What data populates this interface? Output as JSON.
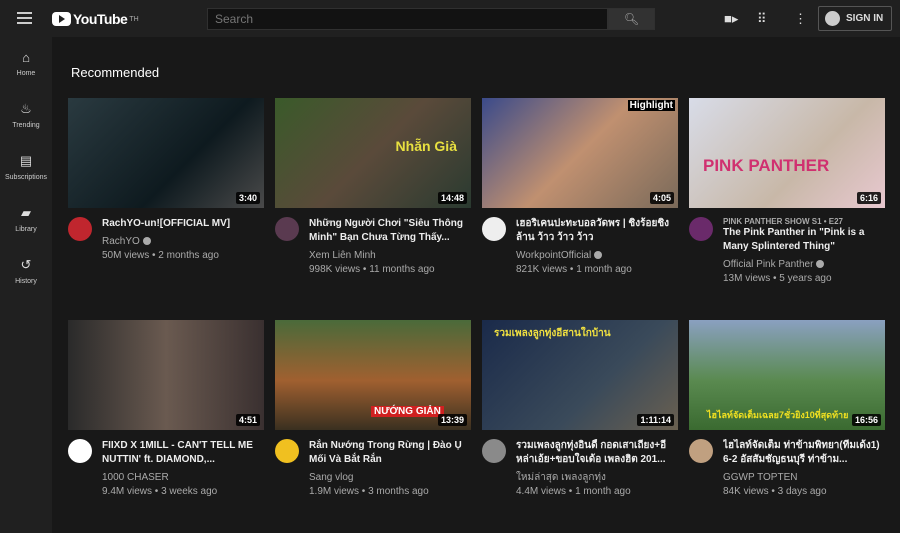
{
  "header": {
    "logo": "YouTube",
    "logo_sup": "TH",
    "search_placeholder": "Search",
    "sign_in": "SIGN IN"
  },
  "sidebar": [
    {
      "label": "Home",
      "icon": "home-icon",
      "glyph": "⌂"
    },
    {
      "label": "Trending",
      "icon": "flame-icon",
      "glyph": "♨"
    },
    {
      "label": "Subscriptions",
      "icon": "subscriptions-icon",
      "glyph": "▤"
    },
    {
      "label": "Library",
      "icon": "folder-icon",
      "glyph": "▰"
    },
    {
      "label": "History",
      "icon": "history-icon",
      "glyph": "↺"
    }
  ],
  "section_title": "Recommended",
  "videos": [
    {
      "title": "RachYO-un![OFFICIAL MV]",
      "channel": "RachYO",
      "verified": true,
      "views": "50M views • 2 months ago",
      "duration": "3:40",
      "thumb": "linear-gradient(135deg,#2a3a40,#0e1a1f 60%,#4a4a4a)",
      "avatar": "#c0262e",
      "overlay": ""
    },
    {
      "title": "Những Người Chơi \"Siêu Thông Minh\" Bạn Chưa Từng Thấy...",
      "channel": "Xem Liên Minh",
      "verified": false,
      "views": "998K views • 11 months ago",
      "duration": "14:48",
      "thumb": "linear-gradient(135deg,#3a5a2a,#5a4a3a 50%,#2a3a30)",
      "avatar": "#5a3a50",
      "overlay": "Nhẵn Già"
    },
    {
      "title": "เฮอริเคนปะทะบอลวัดพร | ชิงร้อยชิงล้าน ว้าว ว้าว ว้าว",
      "channel": "WorkpointOfficial",
      "verified": true,
      "views": "821K views • 1 month ago",
      "duration": "4:05",
      "thumb": "linear-gradient(135deg,#3a4a8a,#c09070 50%,#7a6a5a)",
      "avatar": "#eeeeee",
      "overlay": "Highlight"
    },
    {
      "title": "The Pink Panther in \"Pink is a Many Splintered Thing\"",
      "shelf": "PINK PANTHER SHOW  S1 • E27",
      "channel": "Official Pink Panther",
      "verified": true,
      "views": "13M views • 5 years ago",
      "duration": "6:16",
      "thumb": "linear-gradient(135deg,#d8dce8,#c8b8a8 60%,#e8c8d0)",
      "avatar": "#6a2a6a",
      "overlay": "PINK PANTHER"
    },
    {
      "title": "FIIXD X 1MILL - CAN'T TELL ME NUTTIN' ft. DIAMOND,...",
      "channel": "1000 CHASER",
      "verified": false,
      "views": "9.4M views • 3 weeks ago",
      "duration": "4:51",
      "thumb": "linear-gradient(90deg,#2a2a2a,#6a5a50 50%,#3a3030)",
      "avatar": "#ffffff",
      "overlay": ""
    },
    {
      "title": "Rắn Nướng Trong Rừng | Đào Ụ Mối Và Bắt Rắn",
      "channel": "Sang vlog",
      "verified": false,
      "views": "1.9M views • 3 months ago",
      "duration": "13:39",
      "thumb": "linear-gradient(180deg,#4a6a3a,#a06030 55%,#3a3020)",
      "avatar": "#f0c020",
      "overlay": "NƯỚNG GIẢN"
    },
    {
      "title": "รวมเพลงลูกทุ่งอินดี้ กอดเสาเถียง+อีหล่าเอ้ย+ขอบใจเด้อ เพลงฮิต 201...",
      "channel": "ใหม่ล่าสุด เพลงลูกทุ่ง",
      "verified": false,
      "views": "4.4M views • 1 month ago",
      "duration": "1:11:14",
      "thumb": "linear-gradient(135deg,#1a2a4a,#3a4a5a 60%,#6a6050)",
      "avatar": "#8a8a8a",
      "overlay": "รวมเพลงลูกทุ่งอีสานใกบ้าน"
    },
    {
      "title": "ไฮไลท์จัดเต็ม ท่าข้ามพิทยา(ทีมเด้ง1) 6-2 อัสสัมชัญธนบุรี ท่าข้าม...",
      "channel": "GGWP TOPTEN",
      "verified": false,
      "views": "84K views • 3 days ago",
      "duration": "16:56",
      "thumb": "linear-gradient(180deg,#8aa0c0,#5a8a50 55%,#3a6a30)",
      "avatar": "#c0a080",
      "overlay": "ไฮไลท์จัดเต็มเฉลย7ชั่วยิง10ที่สุดท้าย"
    }
  ]
}
